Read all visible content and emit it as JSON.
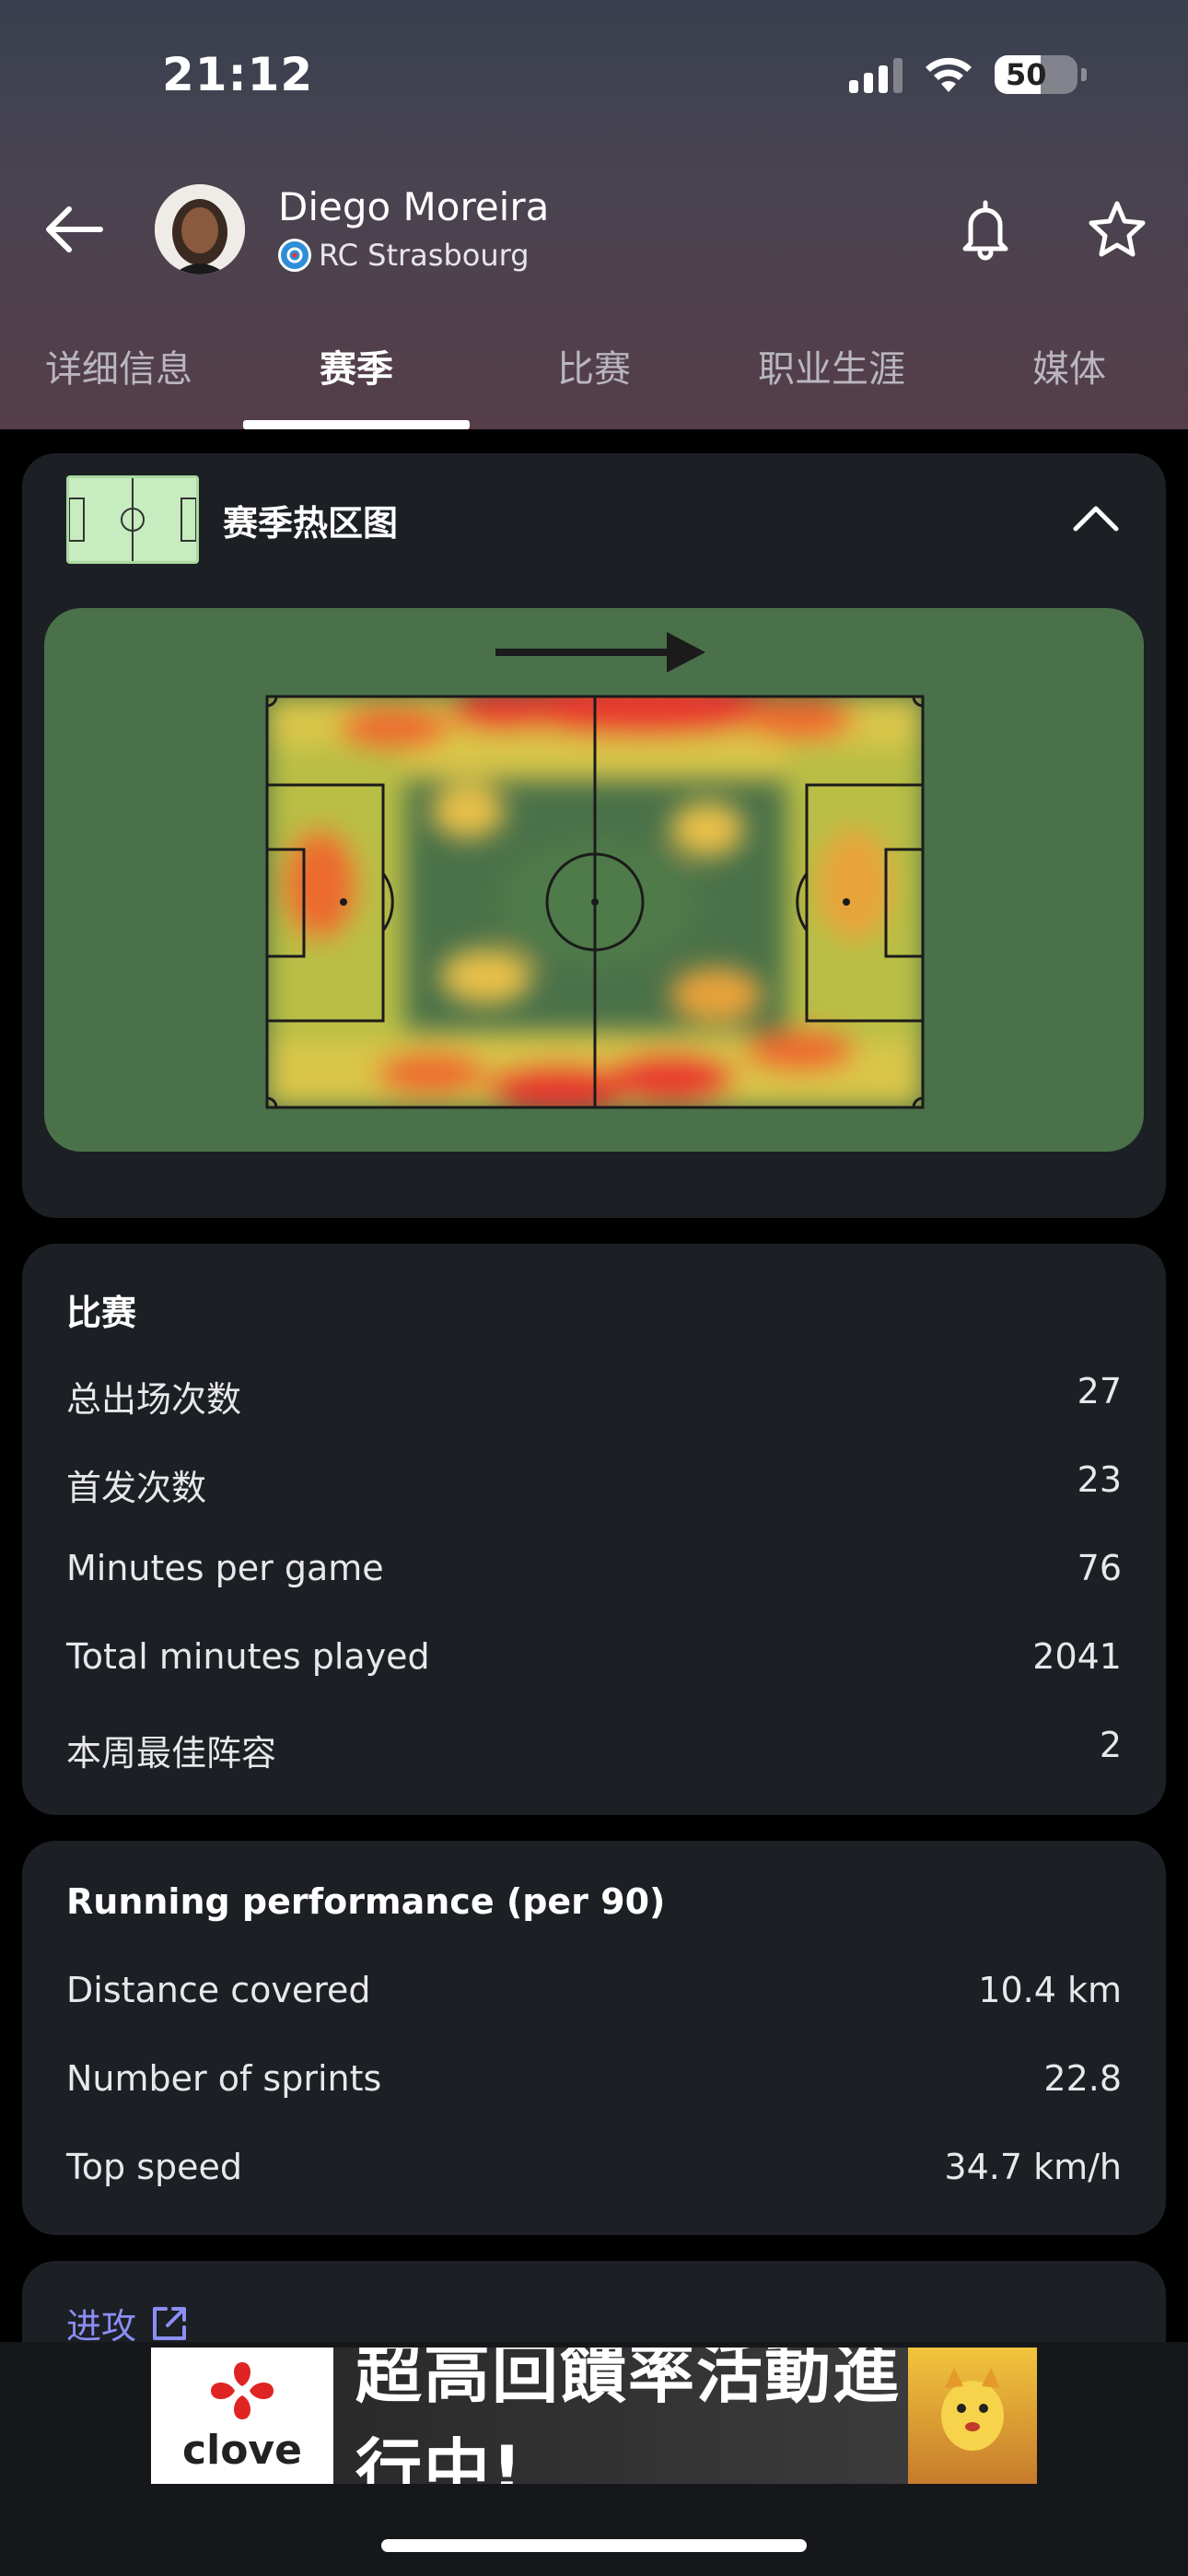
{
  "status": {
    "time": "21:12",
    "battery": "50"
  },
  "player": {
    "name": "Diego Moreira",
    "club": "RC Strasbourg"
  },
  "tabs": [
    {
      "label": "详细信息"
    },
    {
      "label": "赛季"
    },
    {
      "label": "比赛"
    },
    {
      "label": "职业生涯"
    },
    {
      "label": "媒体"
    }
  ],
  "heatmap": {
    "title": "赛季热区图"
  },
  "match": {
    "title": "比赛",
    "rows": [
      {
        "label": "总出场次数",
        "value": "27"
      },
      {
        "label": "首发次数",
        "value": "23"
      },
      {
        "label": "Minutes per game",
        "value": "76"
      },
      {
        "label": "Total minutes played",
        "value": "2041"
      },
      {
        "label": "本周最佳阵容",
        "value": "2"
      }
    ]
  },
  "running": {
    "title": "Running performance (per 90)",
    "rows": [
      {
        "label": "Distance covered",
        "value": "10.4 km"
      },
      {
        "label": "Number of sprints",
        "value": "22.8"
      },
      {
        "label": "Top speed",
        "value": "34.7 km/h"
      }
    ]
  },
  "attack": {
    "label": "进攻"
  },
  "ad": {
    "brand": "clove",
    "text": "超高回饋率活動進行中!"
  },
  "colors": {
    "accent": "#8b8ef4",
    "card": "#1c1f24",
    "pitch": "#4a7149"
  }
}
